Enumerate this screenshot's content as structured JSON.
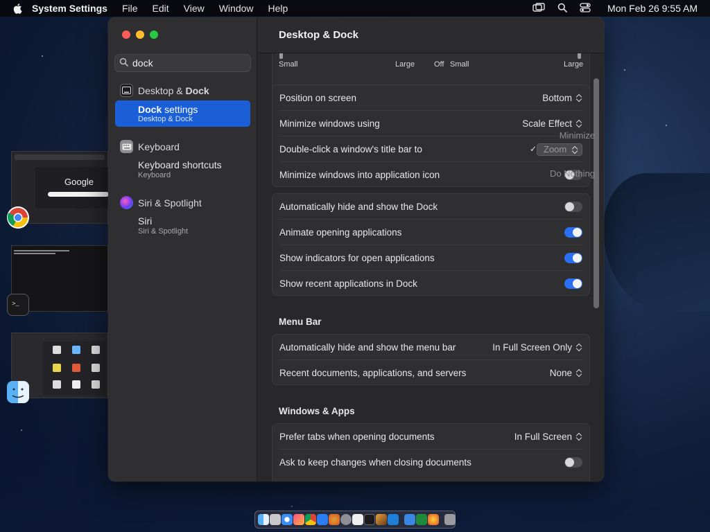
{
  "menubar": {
    "app_name": "System Settings",
    "items": [
      "File",
      "Edit",
      "View",
      "Window",
      "Help"
    ],
    "clock": "Mon Feb 26  9:55 AM"
  },
  "window": {
    "search": {
      "value": "dock"
    },
    "sidebar": {
      "group1": {
        "label_plain": "Desktop & ",
        "label_bold": "Dock"
      },
      "selected": {
        "title_bold": "Dock",
        "title_rest": " settings",
        "subtitle": "Desktop & Dock"
      },
      "group2": {
        "label": "Keyboard"
      },
      "group2_sub": {
        "title": "Keyboard shortcuts",
        "subtitle": "Keyboard"
      },
      "group3": {
        "label": "Siri & Spotlight"
      },
      "group3_sub": {
        "title": "Siri",
        "subtitle": "Siri & Spotlight"
      }
    },
    "content": {
      "title": "Desktop & Dock",
      "sliders": {
        "size_min": "Small",
        "size_max": "Large",
        "mag_off": "Off",
        "mag_min": "Small",
        "mag_max": "Large"
      },
      "dock_rows": [
        {
          "label": "Position on screen",
          "value": "Bottom"
        },
        {
          "label": "Minimize windows using",
          "value": "Scale Effect"
        },
        {
          "label": "Double-click a window's title bar to",
          "value": "Zoom"
        },
        {
          "label": "Minimize windows into application icon"
        }
      ],
      "popup_options": [
        "Minimize",
        "Zoom",
        "Do Nothing"
      ],
      "popup_check": "✓",
      "toggle_rows": [
        {
          "label": "Automatically hide and show the Dock",
          "on": false
        },
        {
          "label": "Animate opening applications",
          "on": true
        },
        {
          "label": "Show indicators for open applications",
          "on": true
        },
        {
          "label": "Show recent applications in Dock",
          "on": true
        }
      ],
      "menu_bar_section": "Menu Bar",
      "menu_bar_rows": [
        {
          "label": "Automatically hide and show the menu bar",
          "value": "In Full Screen Only"
        },
        {
          "label": "Recent documents, applications, and servers",
          "value": "None"
        }
      ],
      "windows_section": "Windows & Apps",
      "windows_rows": [
        {
          "label": "Prefer tabs when opening documents",
          "value": "In Full Screen"
        },
        {
          "label": "Ask to keep changes when closing documents",
          "on": false
        }
      ]
    }
  },
  "desktop": {
    "thumb_google_text": "Google"
  },
  "colors": {
    "accent": "#1a5fd8",
    "toggle_on": "#2b6ff3",
    "close": "#ff5f57",
    "minimize": "#febc2e",
    "zoom": "#28c840"
  }
}
